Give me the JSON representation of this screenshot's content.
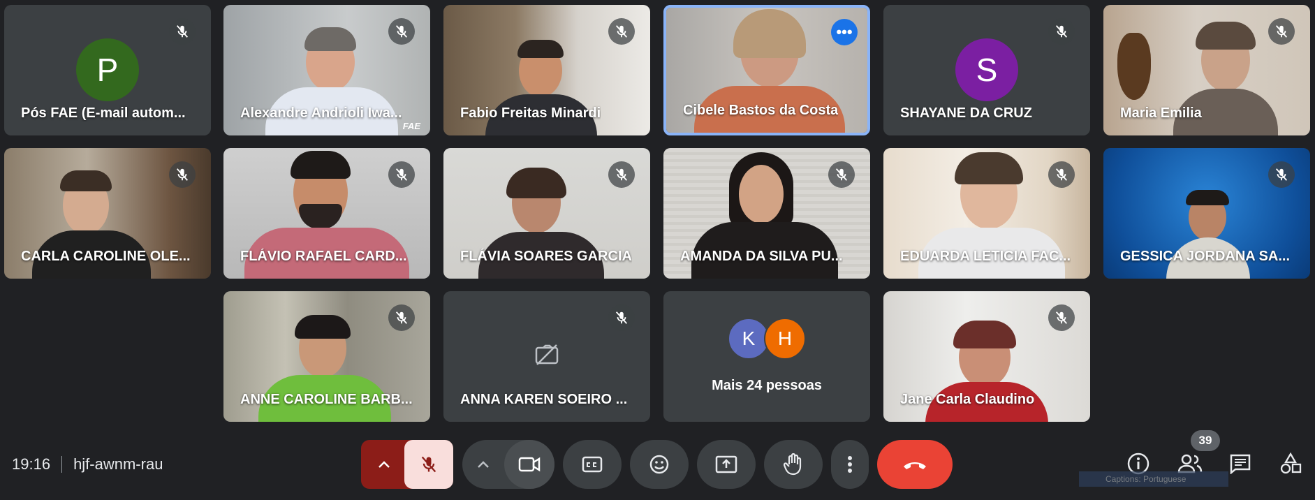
{
  "participants": [
    {
      "name": "Pós FAE (E-mail autom..."
    },
    {
      "name": "Alexandre Andrioli Iwa..."
    },
    {
      "name": "Fabio Freitas Minardi"
    },
    {
      "name": "Cibele Bastos da Costa"
    },
    {
      "name": "SHAYANE DA CRUZ"
    },
    {
      "name": "Maria Emilia"
    },
    {
      "name": "CARLA CAROLINE OLE..."
    },
    {
      "name": "FLÁVIO RAFAEL CARD..."
    },
    {
      "name": "FLÁVIA SOARES GARCIA"
    },
    {
      "name": "AMANDA DA SILVA PU..."
    },
    {
      "name": "EDUARDA LETICIA FAC..."
    },
    {
      "name": "GESSICA JORDANA SA..."
    },
    {
      "name": "ANNE CAROLINE BARB..."
    },
    {
      "name": "ANNA KAREN SOEIRO ..."
    },
    {
      "name": "Jane Carla Claudino"
    }
  ],
  "avatars": {
    "p": {
      "letter": "P",
      "color": "#33691e"
    },
    "s": {
      "letter": "S",
      "color": "#7b1fa2"
    },
    "k": {
      "letter": "K",
      "color": "#5c6bc0"
    },
    "h": {
      "letter": "H",
      "color": "#ef6c00"
    }
  },
  "video_watermark": "FAE",
  "overflow_tile": {
    "label": "Mais 24 pessoas"
  },
  "meeting": {
    "time": "19:16",
    "code": "hjf-awnm-rau"
  },
  "people_count": "39",
  "caption_chip": "Captions: Portuguese",
  "colors": {
    "accent": "#8ab4f8",
    "end_call": "#ea4335",
    "mic_muted_bg": "#f9dedc",
    "mic_group_bg": "#8c1d18"
  },
  "controls": [
    "mic-options-chevron",
    "microphone-muted",
    "camera-options-chevron",
    "camera",
    "captions",
    "emoji-reactions",
    "present-screen",
    "raise-hand",
    "more-options",
    "end-call"
  ],
  "right_controls": [
    "meeting-details",
    "people",
    "chat",
    "activities"
  ]
}
